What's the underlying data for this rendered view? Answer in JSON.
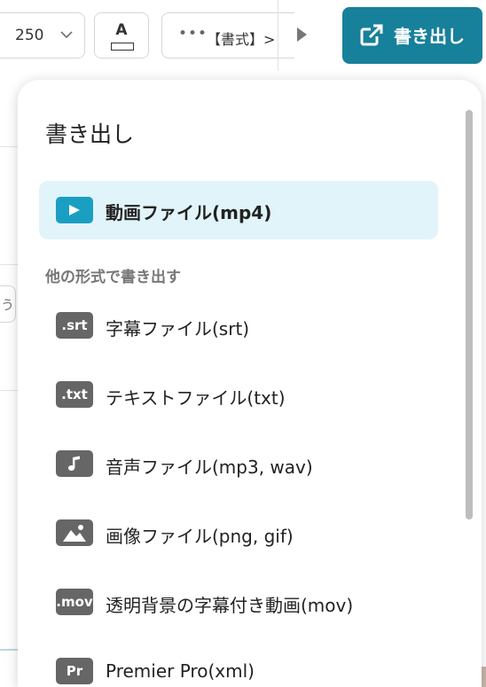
{
  "toolbar": {
    "font_size": "250",
    "color_letter": "A",
    "format_dots": "•••",
    "format_label": "【書式】>",
    "export_label": "書き出し",
    "accent_color": "#17809a"
  },
  "background": {
    "left_chip_text": "う"
  },
  "export_menu": {
    "title": "書き出し",
    "primary": {
      "label": "動画ファイル(mp4)",
      "icon": "play-icon",
      "color": "#1a9fc3"
    },
    "section_label": "他の形式で書き出す",
    "items": [
      {
        "badge": ".srt",
        "label": "字幕ファイル(srt)"
      },
      {
        "badge": ".txt",
        "label": "テキストファイル(txt)"
      },
      {
        "badge": "",
        "icon": "music-note-icon",
        "label": "音声ファイル(mp3, wav)"
      },
      {
        "badge": "",
        "icon": "image-icon",
        "label": "画像ファイル(png, gif)"
      },
      {
        "badge": ".mov",
        "label": "透明背景の字幕付き動画(mov)"
      },
      {
        "badge": "Pr",
        "label": "Premier Pro(xml)"
      }
    ]
  }
}
